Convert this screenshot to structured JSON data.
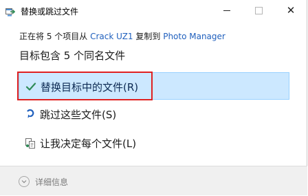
{
  "window": {
    "title": "替换或跳过文件",
    "minimize_icon": "minimize-icon",
    "maximize_icon": "maximize-icon",
    "close_glyph": "✕"
  },
  "info": {
    "prefix": "正在将 5 个项目从 ",
    "source": "Crack UZ1",
    "middle": " 复制到 ",
    "destination": "Photo Manager"
  },
  "headline": "目标包含 5 个同名文件",
  "options": {
    "replace": {
      "label": "替换目标中的文件(R)",
      "icon": "checkmark-icon",
      "color": "#2e8b57",
      "selected": true
    },
    "skip": {
      "label": "跳过这些文件(S)",
      "icon": "skip-arrow-icon"
    },
    "decide": {
      "label": "让我决定每个文件(L)",
      "icon": "compare-files-icon"
    }
  },
  "footer": {
    "details_label": "详细信息",
    "details_icon": "chevron-down-icon"
  },
  "colors": {
    "accent_link": "#1f5fbd",
    "selection_bg": "#cce8ff",
    "highlight_frame": "#e02020"
  }
}
